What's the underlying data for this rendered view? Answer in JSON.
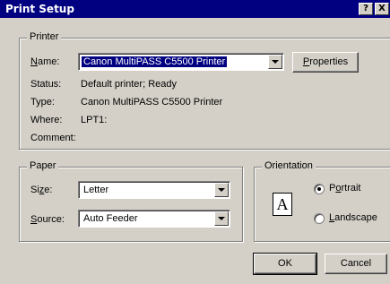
{
  "window": {
    "title": "Print Setup",
    "help_label": "?",
    "close_label": "X"
  },
  "printer": {
    "group_title": "Printer",
    "name_label": "Name:",
    "name_value": "Canon MultiPASS C5500 Printer",
    "properties_label": "Properties",
    "status_label": "Status:",
    "status_value": "Default printer; Ready",
    "type_label": "Type:",
    "type_value": "Canon MultiPASS C5500 Printer",
    "where_label": "Where:",
    "where_value": "LPT1:",
    "comment_label": "Comment:",
    "comment_value": ""
  },
  "paper": {
    "group_title": "Paper",
    "size_label": "Size:",
    "size_value": "Letter",
    "source_label": "Source:",
    "source_value": "Auto Feeder"
  },
  "orientation": {
    "group_title": "Orientation",
    "icon_letter": "A",
    "portrait_label": "Portrait",
    "landscape_label": "Landscape",
    "selected": "Portrait"
  },
  "buttons": {
    "ok_label": "OK",
    "cancel_label": "Cancel"
  }
}
